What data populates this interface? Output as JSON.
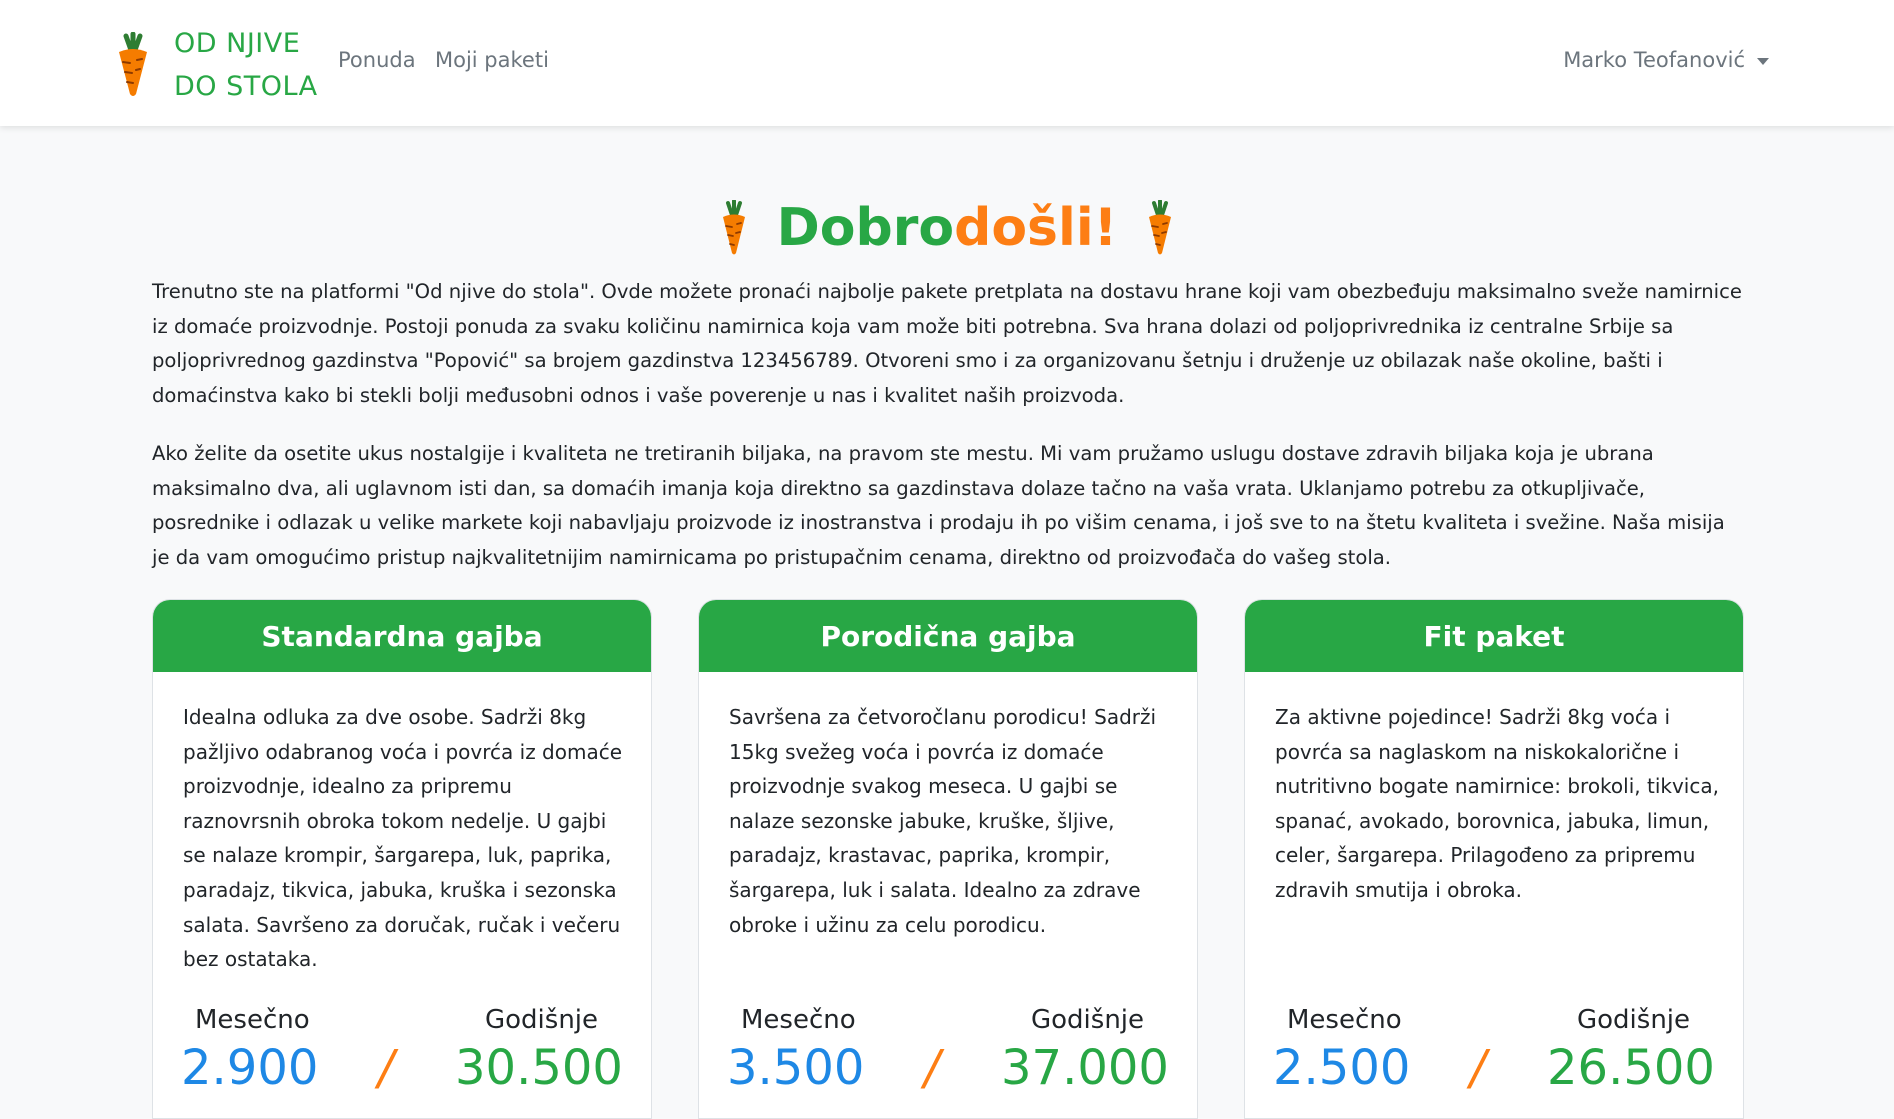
{
  "navbar": {
    "brand_line1": "OD NJIVE",
    "brand_line2": "DO STOLA",
    "brand_icon": "carrot-icon",
    "links": [
      "Ponuda",
      "Moji paketi"
    ],
    "user_name": "Marko Teofanović"
  },
  "welcome": {
    "title_part1": "Dobro",
    "title_part2": "došli!",
    "icon": "carrot-icon"
  },
  "intro": {
    "paragraph1": "Trenutno ste na platformi \"Od njive do stola\". Ovde možete pronaći najbolje pakete pretplata na dostavu hrane koji vam obezbeđuju maksimalno sveže namirnice iz domaće proizvodnje. Postoji ponuda za svaku količinu namirnica koja vam može biti potrebna. Sva hrana dolazi od poljoprivrednika iz centralne Srbije sa poljoprivrednog gazdinstva \"Popović\" sa brojem gazdinstva 123456789. Otvoreni smo i za organizovanu šetnju i druženje uz obilazak naše okoline, bašti i domaćinstva kako bi stekli bolji međusobni odnos i vaše poverenje u nas i kvalitet naših proizvoda.",
    "paragraph2": "Ako želite da osetite ukus nostalgije i kvaliteta ne tretiranih biljaka, na pravom ste mestu. Mi vam pružamo uslugu dostave zdravih biljaka koja je ubrana maksimalno dva, ali uglavnom isti dan, sa domaćih imanja koja direktno sa gazdinstava dolaze tačno na vaša vrata. Uklanjamo potrebu za otkupljivače, posrednike i odlazak u velike markete koji nabavljaju proizvode iz inostranstva i prodaju ih po višim cenama, i još sve to na štetu kvaliteta i svežine. Naša misija je da vam omogućimo pristup najkvalitetnijim namirnicama po pristupačnim cenama, direktno od proizvođača do vašeg stola."
  },
  "packages": [
    {
      "title": "Standardna gajba",
      "description": "Idealna odluka za dve osobe. Sadrži 8kg pažljivo odabranog voća i povrća iz domaće proizvodnje, idealno za pripremu raznovrsnih obroka tokom nedelje. U gajbi se nalaze krompir, šargarepa, luk, paprika, paradajz, tikvica, jabuka, kruška i sezonska salata. Savršeno za doručak, ručak i večeru bez ostataka.",
      "monthly_label": "Mesečno",
      "yearly_label": "Godišnje",
      "monthly_price": "2.900",
      "yearly_price": "30.500",
      "separator": "/"
    },
    {
      "title": "Porodična gajba",
      "description": "Savršena za četvoročlanu porodicu! Sadrži 15kg svežeg voća i povrća iz domaće proizvodnje svakog meseca. U gajbi se nalaze sezonske jabuke, kruške, šljive, paradajz, krastavac, paprika, krompir, šargarepa, luk i salata. Idealno za zdrave obroke i užinu za celu porodicu.",
      "monthly_label": "Mesečno",
      "yearly_label": "Godišnje",
      "monthly_price": "3.500",
      "yearly_price": "37.000",
      "separator": "/"
    },
    {
      "title": "Fit paket",
      "description": "Za aktivne pojedince! Sadrži 8kg voća i povrća sa naglaskom na niskokalorične i nutritivno bogate namirnice: brokoli, tikvica, spanać, avokado, borovnica, jabuka, limun, celer, šargarepa. Prilagođeno za pripremu zdravih smutija i obroka.",
      "monthly_label": "Mesečno",
      "yearly_label": "Godišnje",
      "monthly_price": "2.500",
      "yearly_price": "26.500",
      "separator": "/"
    }
  ],
  "colors": {
    "brand_green": "#28a745",
    "accent_orange": "#fd7e14",
    "price_blue": "#1e88e5"
  }
}
